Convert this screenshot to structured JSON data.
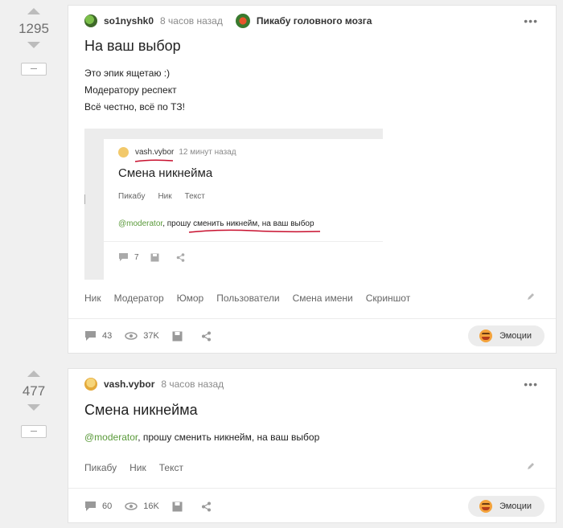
{
  "posts": [
    {
      "rating": "1295",
      "author": "so1nyshk0",
      "time": "8 часов назад",
      "community": "Пикабу головного мозга",
      "title": "На ваш выбор",
      "lines": [
        "Это эпик ящетаю :)",
        "Модератору респект",
        "Всё честно, всё по ТЗ!"
      ],
      "tags": [
        "Ник",
        "Модератор",
        "Юмор",
        "Пользователи",
        "Смена имени",
        "Скриншот"
      ],
      "comments": "43",
      "views": "37K",
      "emotions_label": "Эмоции"
    },
    {
      "rating": "477",
      "author": "vash.vybor",
      "time": "8 часов назад",
      "title": "Смена никнейма",
      "mention": "@moderator",
      "text": ", прошу сменить никнейм, на ваш выбор",
      "tags": [
        "Пикабу",
        "Ник",
        "Текст"
      ],
      "comments": "60",
      "views": "16K",
      "emotions_label": "Эмоции"
    }
  ],
  "embedded": {
    "author": "vash.vybor",
    "time": "12 минут назад",
    "title": "Смена никнейма",
    "tags": [
      "Пикабу",
      "Ник",
      "Текст"
    ],
    "mention": "@moderator",
    "text": ", прошу сменить никнейм, на ваш выбор",
    "comments": "7",
    "underline_color": "#c8102e"
  },
  "colors": {
    "mention": "#5a9a3a",
    "emoji_face": "#f4a33c"
  }
}
